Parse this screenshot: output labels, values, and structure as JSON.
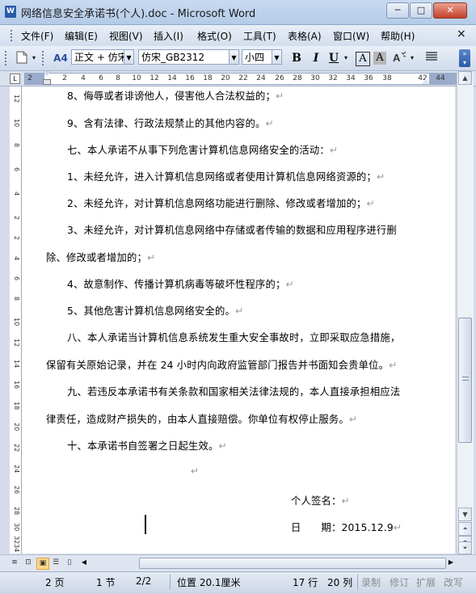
{
  "window": {
    "app_icon": "W",
    "title": "网络信息安全承诺书(个人).doc - Microsoft Word",
    "controls": [
      "─",
      "□",
      "✕"
    ]
  },
  "menu": {
    "items": [
      "文件(F)",
      "编辑(E)",
      "视图(V)",
      "插入(I)",
      "格式(O)",
      "工具(T)",
      "表格(A)",
      "窗口(W)",
      "帮助(H)"
    ],
    "close_doc": "×"
  },
  "toolbar": {
    "style_value": "正文 + 仿宋",
    "font_value": "仿宋_GB2312",
    "size_value": "小四",
    "bold": "B",
    "italic": "I",
    "underline": "U",
    "char_border": "A",
    "char_shading": "A",
    "styles_icon": "A4"
  },
  "ruler": {
    "labels": [
      "2",
      "2",
      "4",
      "6",
      "8",
      "10",
      "12",
      "14",
      "16",
      "18",
      "20",
      "22",
      "24",
      "26",
      "28",
      "30",
      "32",
      "34",
      "36",
      "38",
      "42",
      "44"
    ],
    "tab_selector": "L"
  },
  "vruler": {
    "labels": [
      "12",
      "10",
      "8",
      "6",
      "4",
      "2",
      "2",
      "4",
      "6",
      "8",
      "10",
      "12",
      "14",
      "16",
      "18",
      "20",
      "22",
      "24",
      "26",
      "28",
      "30",
      "32",
      "34"
    ]
  },
  "document": {
    "lines": [
      "8、侮辱或者诽谤他人，侵害他人合法权益的；",
      "9、含有法律、行政法规禁止的其他内容的。",
      "七、本人承诺不从事下列危害计算机信息网络安全的活动：",
      "1、未经允许，进入计算机信息网络或者使用计算机信息网络资源的；",
      "2、未经允许，对计算机信息网络功能进行删除、修改或者增加的；",
      "3、未经允许，对计算机信息网络中存储或者传输的数据和应用程序进行删",
      "除、修改或者增加的；",
      "4、故意制作、传播计算机病毒等破坏性程序的；",
      "5、其他危害计算机信息网络安全的。",
      "八、本人承诺当计算机信息系统发生重大安全事故时，立即采取应急措施，",
      "保留有关原始记录，并在 24 小时内向政府监管部门报告并书面知会贵单位。",
      "九、若违反本承诺书有关条款和国家相关法律法规的，本人直接承担相应法",
      "律责任，造成财产损失的，由本人直接赔偿。你单位有权停止服务。",
      "十、本承诺书自签署之日起生效。"
    ],
    "paragraph_mark": "↵",
    "signature_label": "个人签名：",
    "date_label": "日　　期：2015.12.9"
  },
  "status": {
    "page": "2 页",
    "section": "1 节",
    "page_of": "2/2",
    "position": "位置 20.1厘米",
    "line": "17 行",
    "column": "20 列",
    "rec": "录制",
    "trk": "修订",
    "ext": "扩展",
    "ovr": "改写"
  }
}
